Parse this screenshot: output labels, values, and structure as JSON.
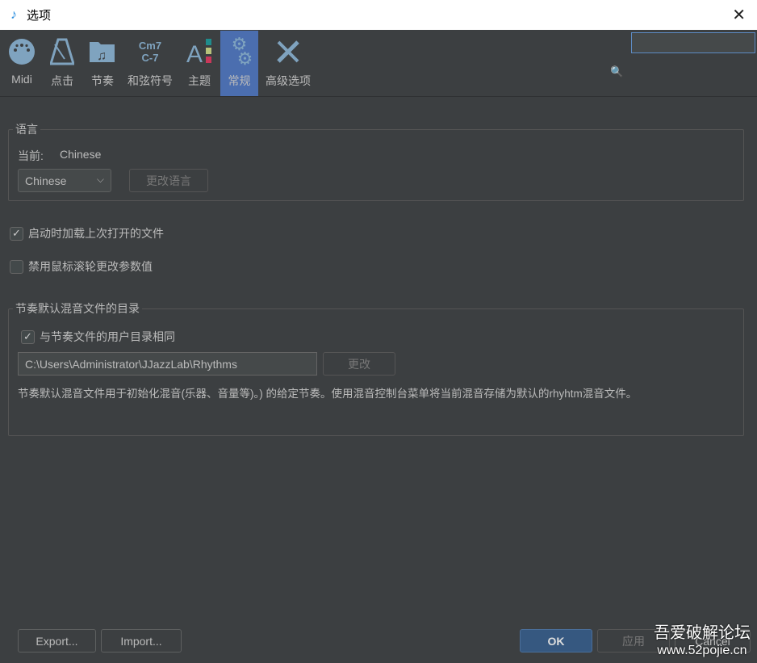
{
  "window": {
    "title": "选项"
  },
  "tabs": [
    {
      "label": "Midi",
      "icon": "midi-connector-icon"
    },
    {
      "label": "点击",
      "icon": "metronome-icon"
    },
    {
      "label": "节奏",
      "icon": "rhythm-folder-icon"
    },
    {
      "label": "和弦符号",
      "icon": "chord-symbol-icon",
      "icon_text": [
        "Cm7",
        "C-7"
      ]
    },
    {
      "label": "主题",
      "icon": "theme-icon"
    },
    {
      "label": "常规",
      "icon": "gears-icon",
      "active": true
    },
    {
      "label": "高级选项",
      "icon": "tools-icon"
    }
  ],
  "search": {
    "value": ""
  },
  "language": {
    "legend": "语言",
    "current_label": "当前:",
    "current_value": "Chinese",
    "select_value": "Chinese",
    "change_button": "更改语言"
  },
  "options": {
    "load_last_file": {
      "label": "启动时加载上次打开的文件",
      "checked": true
    },
    "disable_mouse_wheel": {
      "label": "禁用鼠标滚轮更改参数值",
      "checked": false
    }
  },
  "mix_dir": {
    "legend": "节奏默认混音文件的目录",
    "same_as_user": {
      "label": "与节奏文件的用户目录相同",
      "checked": true
    },
    "path": "C:\\Users\\Administrator\\JJazzLab\\Rhythms",
    "change_button": "更改",
    "description": "节奏默认混音文件用于初始化混音(乐器、音量等)。) 的给定节奏。使用混音控制台菜单将当前混音存储为默认的rhyhtm混音文件。"
  },
  "footer": {
    "export": "Export...",
    "import": "Import...",
    "ok": "OK",
    "apply": "应用",
    "cancel": "Cancel"
  },
  "watermark": {
    "line1": "吾爱破解论坛",
    "line2": "www.52pojie.cn"
  }
}
